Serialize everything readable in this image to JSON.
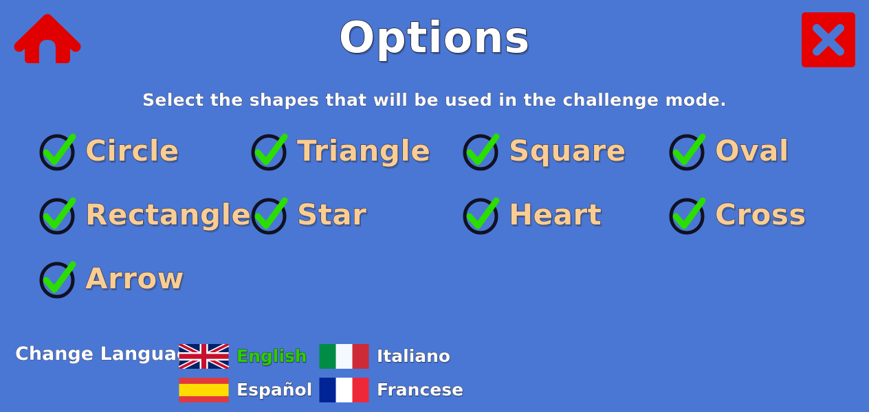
{
  "theme": {
    "background": "#4a77d4",
    "title_color": "#ffffff",
    "shape_label_color": "#f9cd93",
    "check_color": "#2bdd00",
    "selected_language_color": "#2ecc00",
    "home_icon_color": "#e00000",
    "close_button_color": "#e60000"
  },
  "header": {
    "title": "Options",
    "subtitle": "Select the shapes that will be used in the challenge mode.",
    "home_icon": "home-icon",
    "close_icon": "close-x-icon"
  },
  "shapes": {
    "rows": [
      [
        {
          "label": "Circle",
          "checked": true
        },
        {
          "label": "Triangle",
          "checked": true
        },
        {
          "label": "Square",
          "checked": true
        },
        {
          "label": "Oval",
          "checked": true
        }
      ],
      [
        {
          "label": "Rectangle",
          "checked": true
        },
        {
          "label": "Star",
          "checked": true
        },
        {
          "label": "Heart",
          "checked": true
        },
        {
          "label": "Cross",
          "checked": true
        }
      ],
      [
        {
          "label": "Arrow",
          "checked": true
        }
      ]
    ]
  },
  "language": {
    "heading": "Change Language",
    "options": [
      {
        "name": "English",
        "flag": "flag-uk",
        "selected": true
      },
      {
        "name": "Italiano",
        "flag": "flag-italy",
        "selected": false
      },
      {
        "name": "Español",
        "flag": "flag-spain",
        "selected": false
      },
      {
        "name": "Francese",
        "flag": "flag-france",
        "selected": false
      }
    ]
  }
}
